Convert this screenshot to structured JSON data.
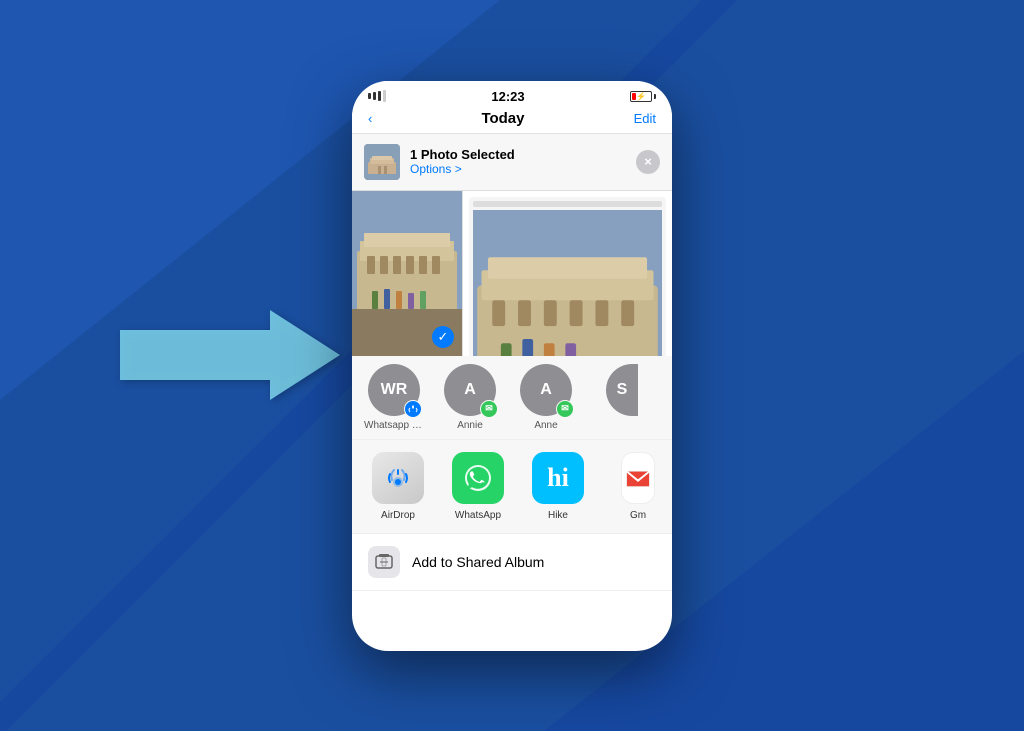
{
  "background": {
    "color": "#1a4fa0"
  },
  "status_bar": {
    "time": "12:23",
    "battery_low": true
  },
  "nav": {
    "title": "Today",
    "edit_label": "Edit"
  },
  "share_header": {
    "title": "1 Photo Selected",
    "options_label": "Options >",
    "close_label": "×"
  },
  "contacts": [
    {
      "initials": "WR",
      "name": "Whatsapp\nWho",
      "badge_type": "airdrop"
    },
    {
      "initials": "A",
      "name": "Annie",
      "badge_type": "message"
    },
    {
      "initials": "A",
      "name": "Anne",
      "badge_type": "message"
    },
    {
      "initials": "S",
      "name": "...",
      "badge_type": "none",
      "partial": true
    }
  ],
  "apps": [
    {
      "name": "AirDrop",
      "type": "airdrop"
    },
    {
      "name": "WhatsApp",
      "type": "whatsapp"
    },
    {
      "name": "Hike",
      "type": "hike"
    },
    {
      "name": "Gm...",
      "type": "gmail",
      "partial": true
    }
  ],
  "action_row": {
    "label": "Add to Shared Album"
  }
}
